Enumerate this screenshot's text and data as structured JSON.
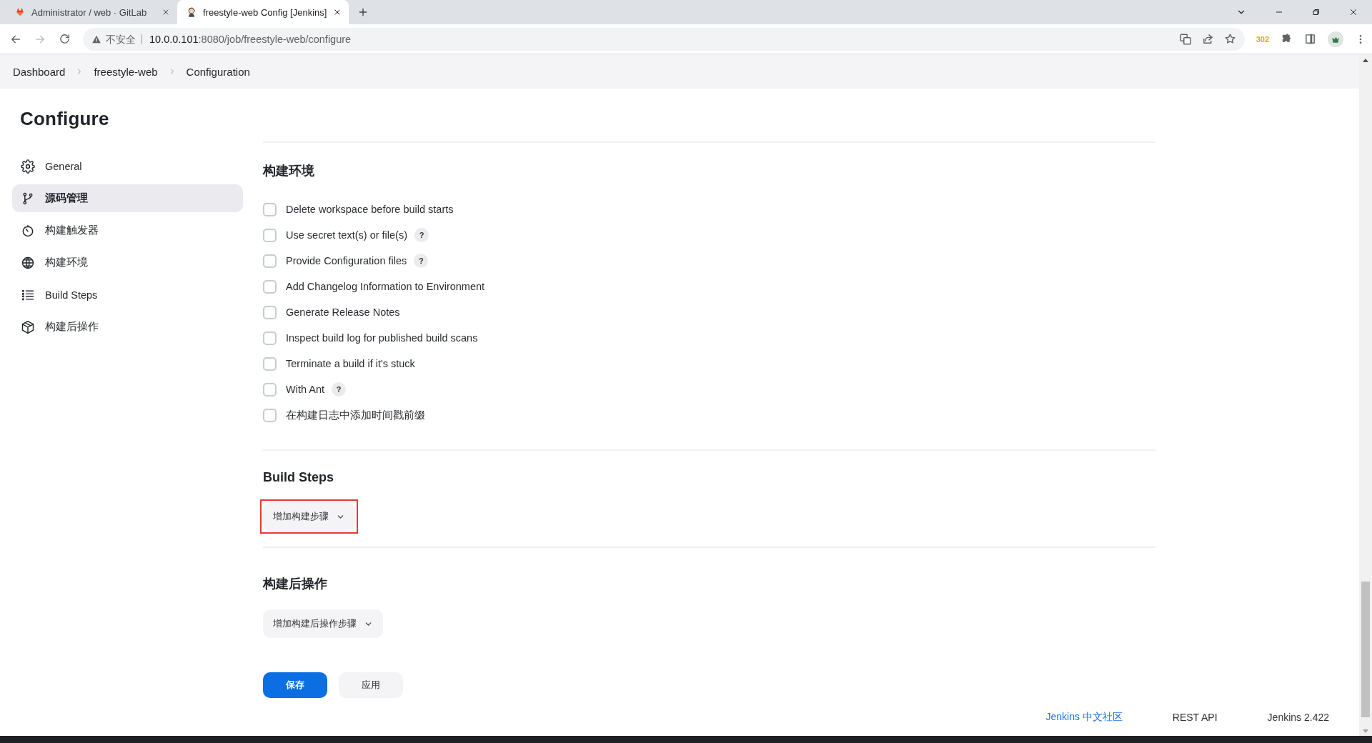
{
  "browser": {
    "tabs": [
      {
        "title": "Administrator / web · GitLab",
        "selected": false
      },
      {
        "title": "freestyle-web Config [Jenkins]",
        "selected": true
      }
    ],
    "security_label": "不安全",
    "url_host": "10.0.0.101",
    "url_path": ":8080/job/freestyle-web/configure",
    "extension_badge": "302"
  },
  "breadcrumbs": [
    "Dashboard",
    "freestyle-web",
    "Configuration"
  ],
  "sidebar": {
    "title": "Configure",
    "items": [
      {
        "label": "General",
        "selected": false
      },
      {
        "label": "源码管理",
        "selected": true
      },
      {
        "label": "构建触发器",
        "selected": false
      },
      {
        "label": "构建环境",
        "selected": false
      },
      {
        "label": "Build Steps",
        "selected": false
      },
      {
        "label": "构建后操作",
        "selected": false
      }
    ]
  },
  "sections": [
    {
      "heading": "构建环境",
      "options": [
        {
          "label": "Delete workspace before build starts",
          "checked": false,
          "help": false
        },
        {
          "label": "Use secret text(s) or file(s)",
          "checked": false,
          "help": true
        },
        {
          "label": "Provide Configuration files",
          "checked": false,
          "help": true
        },
        {
          "label": "Add Changelog Information to Environment",
          "checked": false,
          "help": false
        },
        {
          "label": "Generate Release Notes",
          "checked": false,
          "help": false
        },
        {
          "label": "Inspect build log for published build scans",
          "checked": false,
          "help": false
        },
        {
          "label": "Terminate a build if it's stuck",
          "checked": false,
          "help": false
        },
        {
          "label": "With Ant",
          "checked": false,
          "help": true
        },
        {
          "label": "在构建日志中添加时间戳前缀",
          "checked": false,
          "help": false
        }
      ]
    },
    {
      "heading": "Build Steps",
      "add_button": {
        "label": "增加构建步骤",
        "highlighted": true
      }
    },
    {
      "heading": "构建后操作",
      "add_button": {
        "label": "增加构建后操作步骤",
        "highlighted": false
      }
    }
  ],
  "actions": [
    {
      "label": "保存",
      "primary": true
    },
    {
      "label": "应用",
      "primary": false
    }
  ],
  "help_mark": "?",
  "footer": {
    "links": [
      {
        "label": "Jenkins 中文社区",
        "kind": "link"
      },
      {
        "label": "REST API",
        "kind": "plain"
      },
      {
        "label": "Jenkins 2.422",
        "kind": "plain"
      }
    ]
  }
}
